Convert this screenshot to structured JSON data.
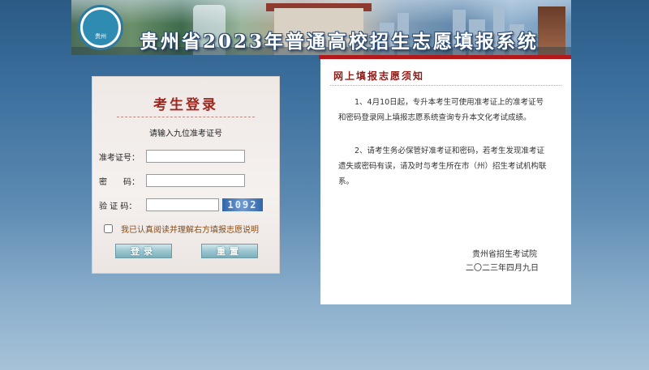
{
  "banner": {
    "title": "贵州省2023年普通高校招生志愿填报系统",
    "logo_text": "贵州"
  },
  "login": {
    "title": "考生登录",
    "hint": "请输入九位准考证号",
    "exam_id_label": "准考证号：",
    "password_label": "密　　码：",
    "captcha_label": "验 证 码：",
    "exam_id_value": "",
    "password_value": "",
    "captcha_value": "",
    "captcha_image_text": "1092",
    "agree_text": "我已认真阅读并理解右方填报志愿说明",
    "login_button": "登录",
    "reset_button": "重置"
  },
  "notice": {
    "title": "网上填报志愿须知",
    "para1": "1、4月10日起，专升本考生可使用准考证上的准考证号和密码登录网上填报志愿系统查询专升本文化考试成绩。",
    "para2": "2、请考生务必保管好准考证和密码，若考生发现准考证遗失或密码有误，请及时与考生所在市（州）招生考试机构联系。",
    "signature_org": "贵州省招生考试院",
    "signature_date": "二〇二三年四月九日"
  },
  "colors": {
    "accent_red": "#b3191a",
    "title_red": "#a0281f",
    "agree_brown": "#8a4a12",
    "button_teal": "#7bb0bd"
  }
}
